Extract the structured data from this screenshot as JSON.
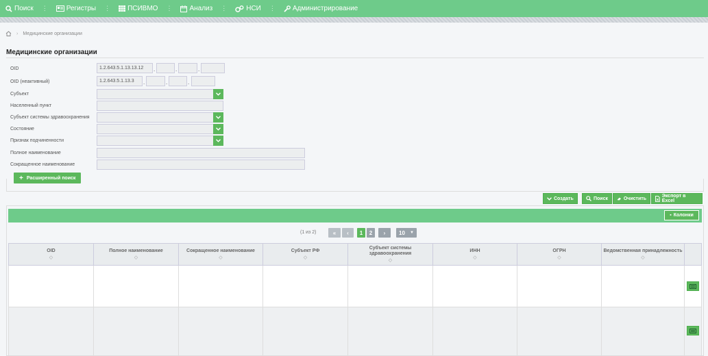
{
  "nav": {
    "items": [
      {
        "label": "Поиск",
        "icon": "search-icon"
      },
      {
        "label": "Регистры",
        "icon": "card-icon"
      },
      {
        "label": "ПСИВМО",
        "icon": "grid-icon"
      },
      {
        "label": "Анализ",
        "icon": "calendar-icon"
      },
      {
        "label": "НСИ",
        "icon": "gears-icon"
      },
      {
        "label": "Администрирование",
        "icon": "wrench-icon"
      }
    ],
    "separator": "⋮"
  },
  "breadcrumb": {
    "current": "Медицинские организации"
  },
  "page_title": "Медицинские организации",
  "form": {
    "oid_label": "OID",
    "oid_value": "1.2.643.5.1.13.13.12",
    "oid_inactive_label": "OID (неактивный)",
    "oid_inactive_value": "1.2.643.5.1.13.3",
    "subject_label": "Субъект",
    "settlement_label": "Населенный пункт",
    "health_subject_label": "Субъект системы здравоохранения",
    "state_label": "Состояние",
    "subordination_label": "Признак подчиненности",
    "full_name_label": "Полное наименование",
    "short_name_label": "Сокращенное наименование"
  },
  "advanced_search": "Расширенный поиск",
  "actions": {
    "create": "Создать",
    "search": "Поиск",
    "clear": "Очистить",
    "export": "Экспорт в Excel"
  },
  "columns_button": "Колонки",
  "pager": {
    "info": "(1 из 2)",
    "pages": [
      "1",
      "2"
    ],
    "page_size": "10"
  },
  "table": {
    "headers": [
      "OID",
      "Полное наименование",
      "Сокращенное наименование",
      "Субъект РФ",
      "Субъект системы здравоохранения",
      "ИНН",
      "ОГРН",
      "Ведомственная принадлежность"
    ],
    "sort_glyph": "◇"
  },
  "colors": {
    "accent": "#6ecb8a",
    "button": "#5cb85c"
  }
}
